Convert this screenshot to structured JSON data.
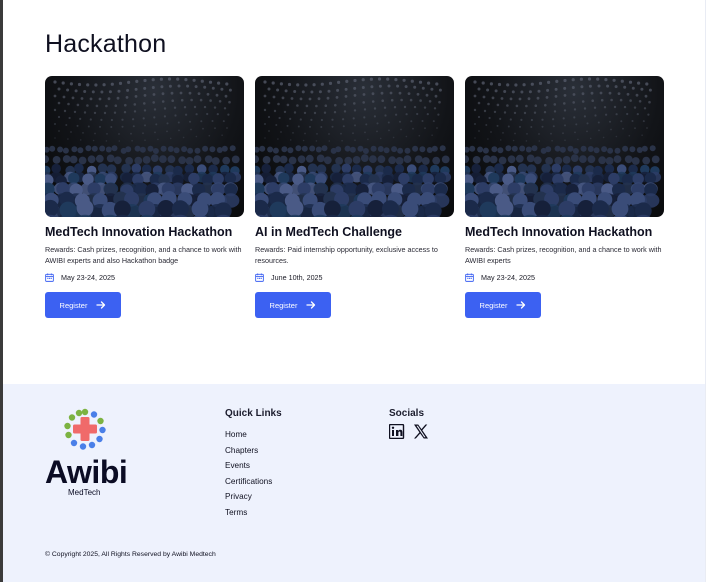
{
  "hackathon": {
    "title": "Hackathon",
    "cards": [
      {
        "title": "MedTech Innovation Hackathon",
        "rewards": "Rewards: Cash prizes, recognition, and a chance to work with AWIBI experts and also Hackathon badge",
        "date": "May 23-24, 2025",
        "button_label": "Register"
      },
      {
        "title": "AI in MedTech Challenge",
        "rewards": "Rewards: Paid internship opportunity, exclusive access to resources.",
        "date": "June 10th, 2025",
        "button_label": "Register"
      },
      {
        "title": "MedTech Innovation Hackathon",
        "rewards": "Rewards: Cash prizes, recognition, and a chance to work with AWIBI experts",
        "date": "May 23-24, 2025",
        "button_label": "Register"
      }
    ]
  },
  "footer": {
    "logo_name": "Awibi",
    "logo_sub": "MedTech",
    "quick_links_title": "Quick Links",
    "quick_links": [
      "Home",
      "Chapters",
      "Events",
      "Certifications",
      "Privacy",
      "Terms"
    ],
    "socials_title": "Socials",
    "socials": [
      "linkedin-icon",
      "x-icon"
    ],
    "copyright": "© Copyright 2025, All Rights Reserved by Awibi Medtech"
  },
  "colors": {
    "accent": "#3c61f2",
    "footer_bg": "#eef2fd",
    "logo_red": "#f06a6a",
    "logo_green": "#7cb342",
    "logo_blue": "#4a7fe8"
  }
}
